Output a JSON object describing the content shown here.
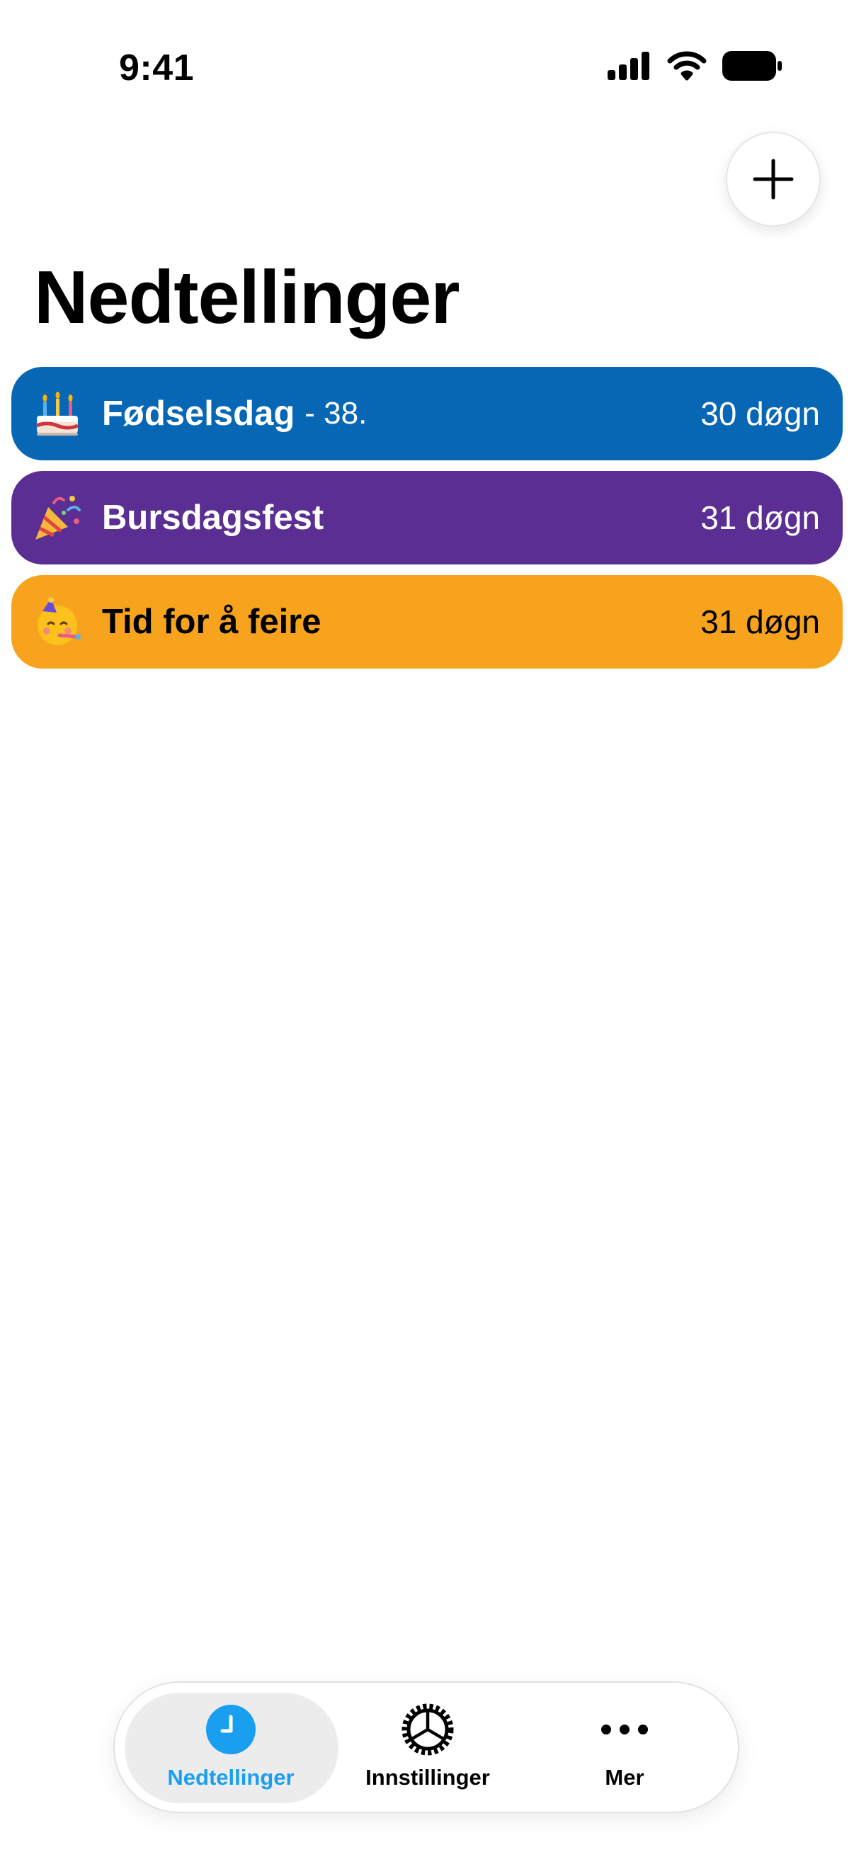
{
  "status_bar": {
    "time": "9:41"
  },
  "header": {
    "title": "Nedtellinger",
    "add_icon": "plus-icon"
  },
  "countdowns": [
    {
      "emoji": "birthday-cake",
      "title": "Fødselsdag",
      "suffix": "- 38.",
      "days": "30 døgn",
      "color": "#0767B4",
      "text_color": "#ffffff"
    },
    {
      "emoji": "party-popper",
      "title": "Bursdagsfest",
      "suffix": "",
      "days": "31 døgn",
      "color": "#5A2E92",
      "text_color": "#ffffff"
    },
    {
      "emoji": "partying-face",
      "title": "Tid for å feire",
      "suffix": "",
      "days": "31 døgn",
      "color": "#F8A31D",
      "text_color": "#000000"
    }
  ],
  "tabbar": {
    "tabs": [
      {
        "label": "Nedtellinger",
        "icon": "clock-icon",
        "active": true,
        "color": "#1A9FF0"
      },
      {
        "label": "Innstillinger",
        "icon": "gear-icon",
        "active": false,
        "color": "#000000"
      },
      {
        "label": "Mer",
        "icon": "ellipsis-icon",
        "active": false,
        "color": "#000000"
      }
    ]
  }
}
